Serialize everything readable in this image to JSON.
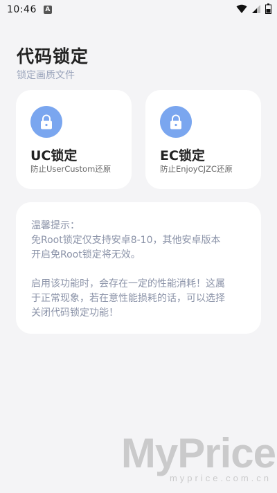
{
  "status_bar": {
    "time": "10:46",
    "notification_icon": "a-icon",
    "icons": [
      "wifi-icon",
      "signal-icon",
      "battery-icon"
    ]
  },
  "header": {
    "title": "代码锁定",
    "subtitle": "锁定画质文件"
  },
  "cards": [
    {
      "title": "UC锁定",
      "description": "防止UserCustom还原",
      "icon": "lock-icon"
    },
    {
      "title": "EC锁定",
      "description": "防止EnjoyCJZC还原",
      "icon": "lock-icon"
    }
  ],
  "tips": {
    "heading": "温馨提示：",
    "line1": "免Root锁定仅支持安卓8-10，其他安卓版本",
    "line2": "开启免Root锁定将无效。",
    "line3": "启用该功能时，会存在一定的性能消耗！这属",
    "line4": "于正常现象，若在意性能损耗的话，可以选择",
    "line5": "关闭代码锁定功能！"
  },
  "watermark": {
    "logo": "MyPrice",
    "url": "myprice.com.cn"
  },
  "colors": {
    "accent": "#7aa6ef",
    "background": "#f4f4f6",
    "card": "#ffffff",
    "tip_text": "#8b93a8",
    "subtitle": "#9aa4bb"
  }
}
